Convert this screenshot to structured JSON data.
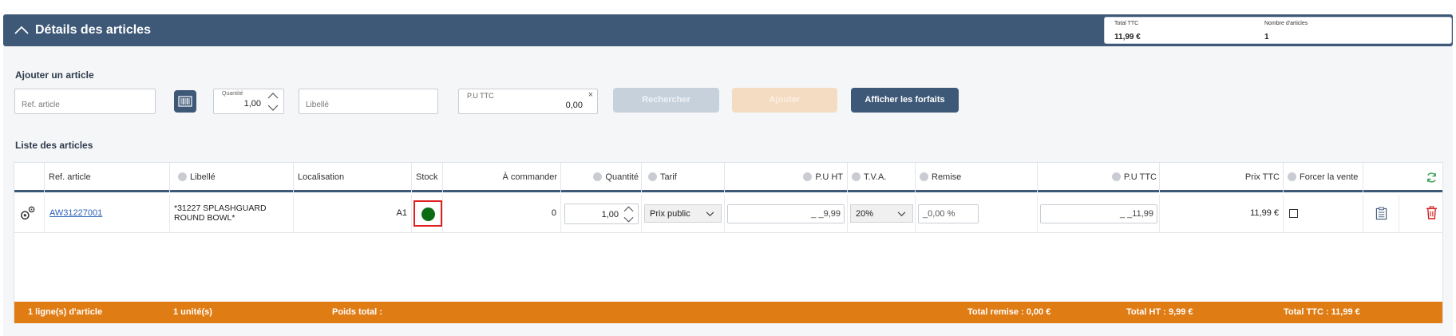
{
  "header": {
    "title": "Détails des articles",
    "summary": {
      "total_ttc_label": "Total TTC",
      "total_ttc_value": "11,99 €",
      "nb_articles_label": "Nombre d'articles",
      "nb_articles_value": "1"
    }
  },
  "add_section": {
    "title": "Ajouter un article",
    "ref_placeholder": "Ref. article",
    "quantity_label": "Quantité",
    "quantity_value": "1,00",
    "libelle_placeholder": "Libellé",
    "pu_ttc_label": "P.U TTC",
    "pu_ttc_value": "0,00",
    "search_button": "Rechercher",
    "add_button": "Ajouter",
    "forfaits_button": "Afficher les forfaits"
  },
  "list_section": {
    "title": "Liste des articles",
    "columns": {
      "ref": "Ref. article",
      "libelle": "Libellé",
      "localisation": "Localisation",
      "stock": "Stock",
      "a_commander": "À commander",
      "quantite": "Quantité",
      "tarif": "Tarif",
      "pu_ht": "P.U HT",
      "tva": "T.V.A.",
      "remise": "Remise",
      "pu_ttc": "P.U TTC",
      "prix_ttc": "Prix TTC",
      "forcer": "Forcer la vente"
    },
    "rows": [
      {
        "ref": "AW31227001",
        "libelle": "*31227 SPLASHGUARD ROUND BOWL*",
        "localisation": "A1",
        "stock_color": "#0a6b12",
        "a_commander": "0",
        "quantite": "1,00",
        "tarif": "Prix public",
        "pu_ht": "_ _9,99",
        "tva": "20%",
        "remise": "_0,00 %",
        "pu_ttc": "_ _11,99",
        "prix_ttc": "11,99 €"
      }
    ],
    "footer": {
      "lines": "1 ligne(s) d'article",
      "units": "1 unité(s)",
      "weight": "Poids total :",
      "total_remise": "Total remise : 0,00 €",
      "total_ht": "Total HT : 9,99 €",
      "total_ttc": "Total TTC : 11,99 €"
    }
  },
  "colors": {
    "header_bg": "#3e5877",
    "footer_bg": "#e07c14",
    "highlight": "#e02020",
    "delete": "#d32020",
    "refresh": "#2e9c4a"
  }
}
